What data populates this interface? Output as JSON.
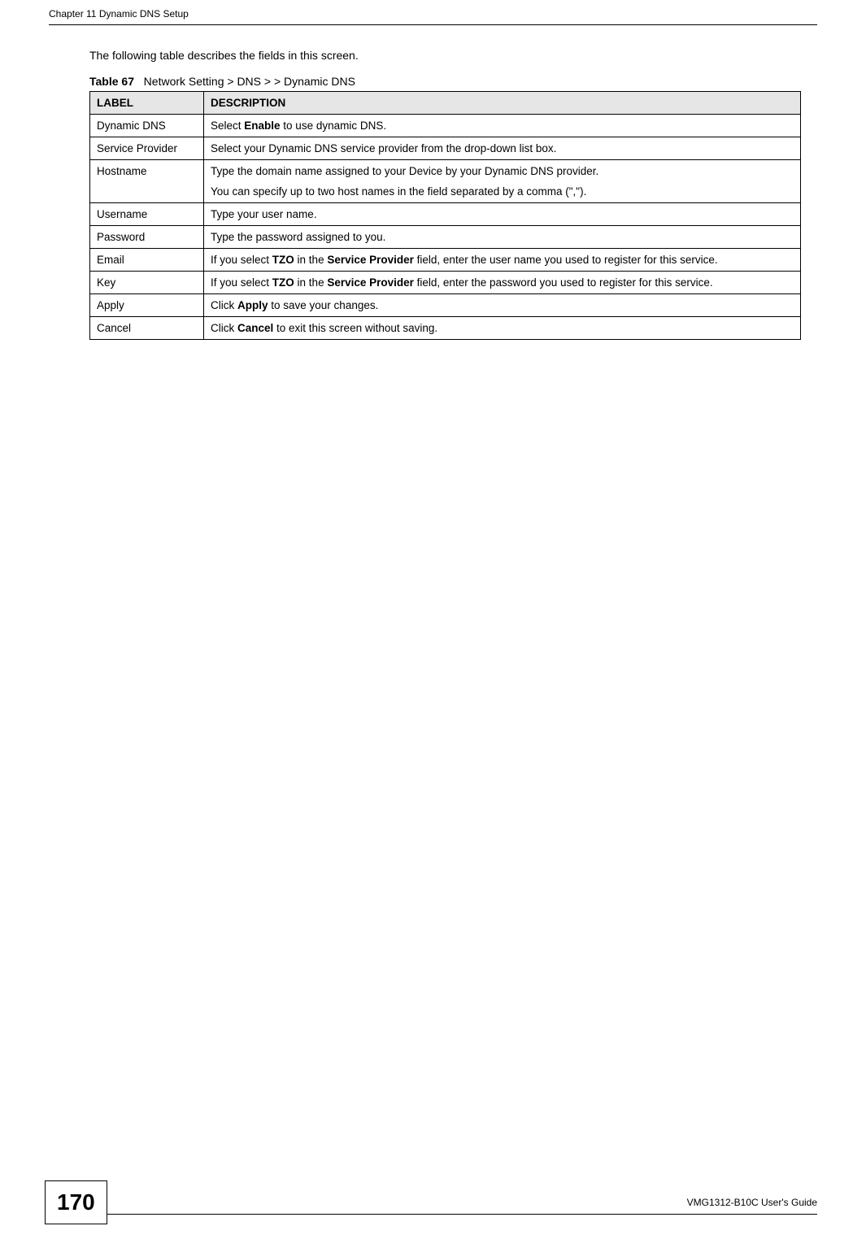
{
  "header": {
    "chapter_title": "Chapter 11 Dynamic DNS Setup"
  },
  "intro": "The following table describes the fields in this screen.",
  "table_caption": {
    "prefix": "Table 67",
    "text": "Network Setting > DNS > > Dynamic DNS"
  },
  "table": {
    "headers": {
      "label": "LABEL",
      "description": "DESCRIPTION"
    },
    "rows": [
      {
        "label": "Dynamic DNS",
        "desc_parts": [
          {
            "text": "Select ",
            "bold": false
          },
          {
            "text": "Enable",
            "bold": true
          },
          {
            "text": " to use dynamic DNS.",
            "bold": false
          }
        ]
      },
      {
        "label": "Service Provider",
        "desc_parts": [
          {
            "text": "Select your Dynamic DNS service provider from the drop-down list box.",
            "bold": false
          }
        ]
      },
      {
        "label": "Hostname",
        "desc_paragraphs": [
          [
            {
              "text": "Type the domain name assigned to your Device by your Dynamic DNS provider.",
              "bold": false
            }
          ],
          [
            {
              "text": "You can specify up to two host names in the field separated by a comma (\",\").",
              "bold": false
            }
          ]
        ]
      },
      {
        "label": "Username",
        "desc_parts": [
          {
            "text": "Type your user name.",
            "bold": false
          }
        ]
      },
      {
        "label": "Password",
        "desc_parts": [
          {
            "text": "Type the password assigned to you.",
            "bold": false
          }
        ]
      },
      {
        "label": "Email",
        "desc_parts": [
          {
            "text": "If you select ",
            "bold": false
          },
          {
            "text": "TZO",
            "bold": true
          },
          {
            "text": " in the ",
            "bold": false
          },
          {
            "text": "Service Provider",
            "bold": true
          },
          {
            "text": " field, enter the user name you used to register for this service.",
            "bold": false
          }
        ]
      },
      {
        "label": "Key",
        "desc_parts": [
          {
            "text": "If you select ",
            "bold": false
          },
          {
            "text": "TZO",
            "bold": true
          },
          {
            "text": " in the ",
            "bold": false
          },
          {
            "text": "Service Provider",
            "bold": true
          },
          {
            "text": " field, enter the password you used to register for this service.",
            "bold": false
          }
        ]
      },
      {
        "label": "Apply",
        "desc_parts": [
          {
            "text": "Click ",
            "bold": false
          },
          {
            "text": "Apply",
            "bold": true
          },
          {
            "text": " to save your changes.",
            "bold": false
          }
        ]
      },
      {
        "label": "Cancel",
        "desc_parts": [
          {
            "text": "Click ",
            "bold": false
          },
          {
            "text": "Cancel",
            "bold": true
          },
          {
            "text": " to exit this screen without saving.",
            "bold": false
          }
        ]
      }
    ]
  },
  "footer": {
    "page_number": "170",
    "guide_title": "VMG1312-B10C User's Guide"
  }
}
